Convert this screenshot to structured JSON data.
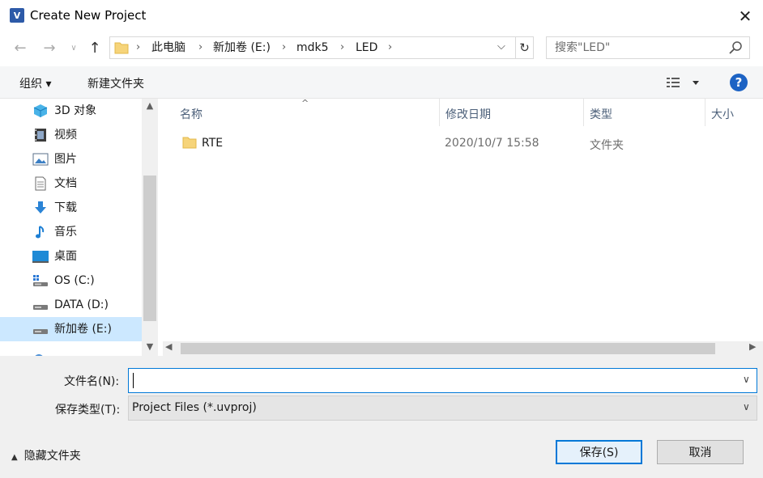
{
  "window": {
    "title": "Create New Project",
    "close_glyph": "✕"
  },
  "address": {
    "crumbs": [
      "此电脑",
      "新加卷 (E:)",
      "mdk5",
      "LED"
    ],
    "separator": "›",
    "dropdown_glyph": "⌵",
    "refresh_glyph": "↻"
  },
  "search": {
    "placeholder": "搜索\"LED\""
  },
  "toolbar": {
    "organize": "组织 ▾",
    "new_folder": "新建文件夹",
    "help": "?"
  },
  "nav": {
    "items": [
      {
        "label": "3D 对象",
        "icon": "3d-objects-icon"
      },
      {
        "label": "视频",
        "icon": "video-icon"
      },
      {
        "label": "图片",
        "icon": "pictures-icon"
      },
      {
        "label": "文档",
        "icon": "documents-icon"
      },
      {
        "label": "下载",
        "icon": "downloads-icon"
      },
      {
        "label": "音乐",
        "icon": "music-icon"
      },
      {
        "label": "桌面",
        "icon": "desktop-icon"
      },
      {
        "label": "OS (C:)",
        "icon": "drive-c-icon"
      },
      {
        "label": "DATA (D:)",
        "icon": "drive-icon"
      },
      {
        "label": "新加卷 (E:)",
        "icon": "drive-icon",
        "selected": true
      }
    ]
  },
  "columns": {
    "name": "名称",
    "modified": "修改日期",
    "type": "类型",
    "size": "大小"
  },
  "files": [
    {
      "name": "RTE",
      "modified": "2020/10/7 15:58",
      "type": "文件夹",
      "icon": "folder-icon"
    }
  ],
  "form": {
    "filename_label": "文件名(N):",
    "filename_value": "",
    "filetype_label": "保存类型(T):",
    "filetype_value": "Project Files (*.uvproj)"
  },
  "footer": {
    "hide_folders": "隐藏文件夹",
    "save": "保存(S)",
    "cancel": "取消"
  },
  "colors": {
    "accent": "#0078d7",
    "selected": "#cce8ff",
    "folder": "#f6d47a",
    "header_text": "#4c607a"
  }
}
